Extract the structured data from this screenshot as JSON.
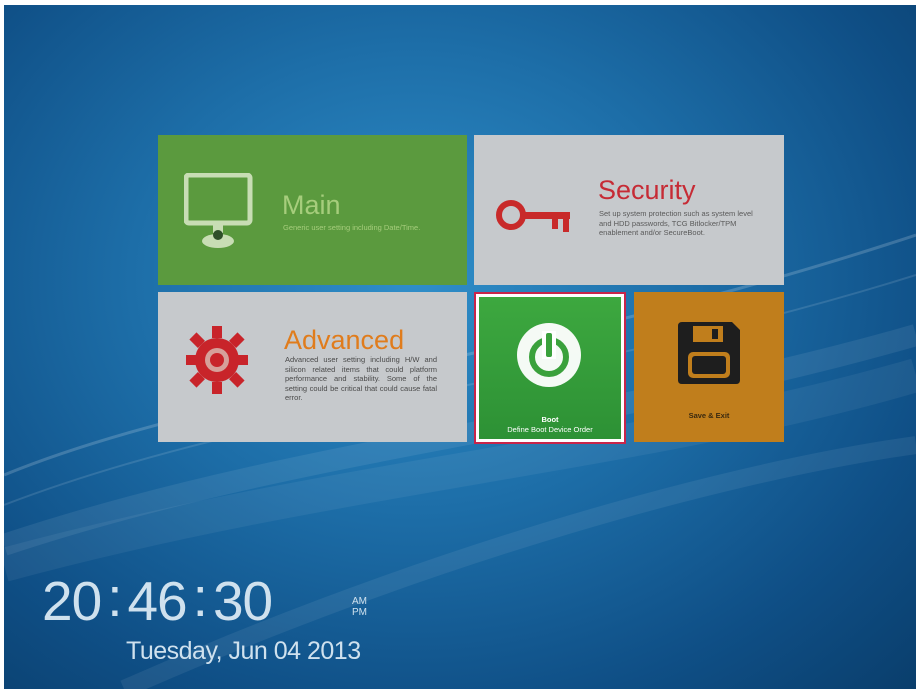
{
  "tiles": {
    "main": {
      "title": "Main",
      "description": "Generic user setting including Date/Time.",
      "icon": "monitor-icon"
    },
    "security": {
      "title": "Security",
      "description": "Set up system protection such as system level and HDD passwords, TCG Bitlocker/TPM enablement and/or SecureBoot.",
      "icon": "key-icon"
    },
    "advanced": {
      "title": "Advanced",
      "description": "Advanced user setting including H/W and silicon related items that could platform performance and stability. Some of the setting could be critical that could cause fatal error.",
      "icon": "gear-icon"
    },
    "boot": {
      "title": "Boot",
      "description": "Define Boot Device Order",
      "icon": "power-icon",
      "selected": true
    },
    "save_exit": {
      "title": "Save & Exit",
      "icon": "floppy-disk-icon"
    }
  },
  "clock": {
    "hours": "20",
    "minutes": "46",
    "seconds": "30",
    "separator": ":",
    "am": "AM",
    "pm": "PM"
  },
  "date": "Tuesday, Jun 04 2013",
  "colors": {
    "main_tile": "#5b9a3e",
    "security_tile": "#c6c9cc",
    "advanced_tile": "#c6c9cc",
    "boot_tile": "#3da83f",
    "save_tile": "#c07e1c",
    "selection_border": "#c8254a"
  }
}
